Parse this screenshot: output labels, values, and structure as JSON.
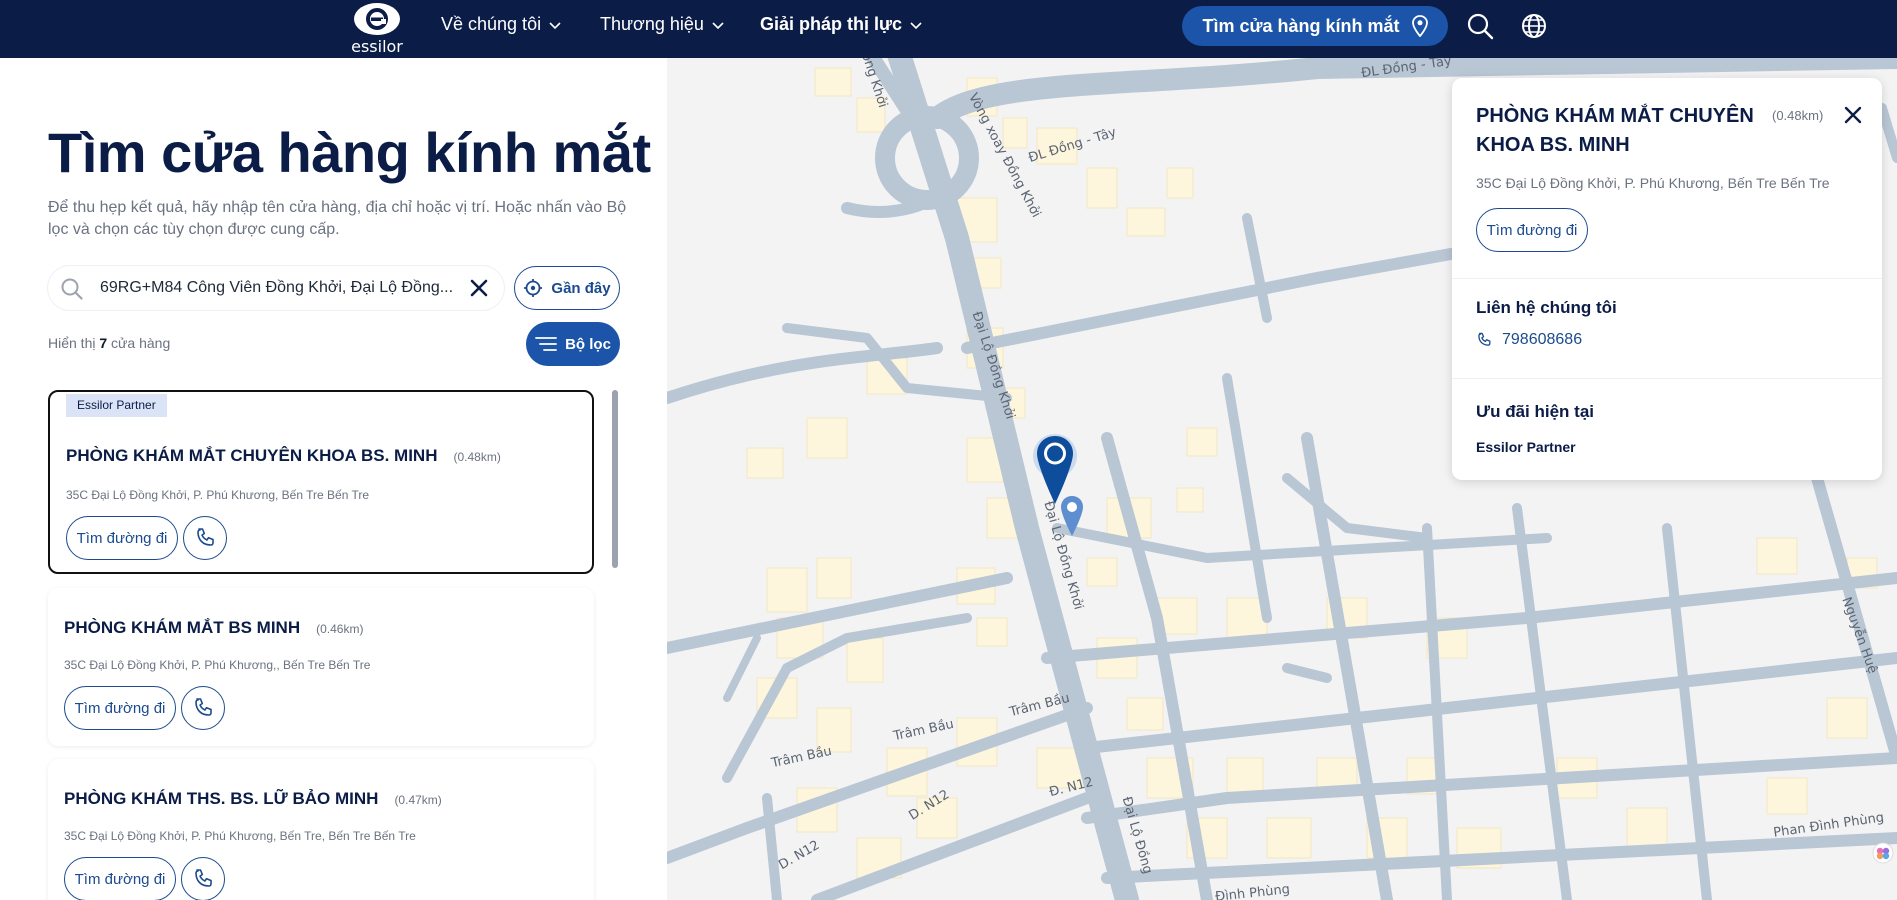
{
  "nav": {
    "logo_text": "essilor",
    "items": [
      {
        "label": "Về chúng tôi"
      },
      {
        "label": "Thương hiệu"
      },
      {
        "label": "Giải pháp thị lực"
      }
    ],
    "store_button": "Tìm cửa hàng kính mắt"
  },
  "page": {
    "title": "Tìm cửa hàng kính mắt",
    "description": "Để thu hẹp kết quả, hãy nhập tên cửa hàng, địa chỉ hoặc vị trí. Hoặc nhấn vào Bộ lọc và chọn các tùy chọn được cung cấp."
  },
  "search": {
    "value": "69RG+M84 Công Viên Đồng Khởi, Đại Lộ Đồng...",
    "near_label": "Gần đây",
    "filter_label": "Bộ lọc"
  },
  "results": {
    "prefix": "Hiển thị",
    "count": "7",
    "suffix": "cửa hàng"
  },
  "stores": [
    {
      "badge": "Essilor Partner",
      "name": "PHÒNG KHÁM MẮT CHUYÊN KHOA BS. MINH",
      "distance": "(0.48km)",
      "address": "35C Đại Lộ Đồng Khởi, P. Phú Khương, Bến Tre Bến Tre",
      "directions": "Tìm đường đi"
    },
    {
      "name": "PHÒNG KHÁM MẮT BS MINH",
      "distance": "(0.46km)",
      "address": "35C Đại Lộ Đồng Khởi, P. Phú Khương,, Bến Tre Bến Tre",
      "directions": "Tìm đường đi"
    },
    {
      "name": "PHÒNG KHÁM THS. BS. LỮ BẢO MINH",
      "distance": "(0.47km)",
      "address": "35C Đại Lộ Đồng Khởi, P. Phú Khương, Bến Tre, Bến Tre Bến Tre",
      "directions": "Tìm đường đi"
    }
  ],
  "map": {
    "labels": [
      "ĐL Đồng - Tây",
      "ĐL Đồng - Tây",
      "Vòng xoay Đồng Khởi",
      "Đồng Khởi",
      "Đại Lộ Đồng Khởi",
      "Đại Lộ Đồng Khởi",
      "Đại Lộ Đồng",
      "Trâm Bầu",
      "Trâm Bầu",
      "Trâm Bầu",
      "D. N12",
      "D. N12",
      "Đ. N12",
      "Nguyễn Huệ",
      "Phan Đình Phùng",
      "Đình Phùng"
    ],
    "colors": {
      "road": "#b9c6d4",
      "block": "#fdf6dd",
      "marker": "#0e4d9c"
    }
  },
  "info": {
    "title": "PHÒNG KHÁM MẮT CHUYÊN KHOA BS. MINH",
    "distance": "(0.48km)",
    "address": "35C Đại Lộ Đồng Khởi, P. Phú Khương, Bến Tre Bến Tre",
    "directions": "Tìm đường đi",
    "contact_heading": "Liên hệ chúng tôi",
    "phone": "798608686",
    "offers_heading": "Ưu đãi hiện tại",
    "offer": "Essilor Partner"
  }
}
